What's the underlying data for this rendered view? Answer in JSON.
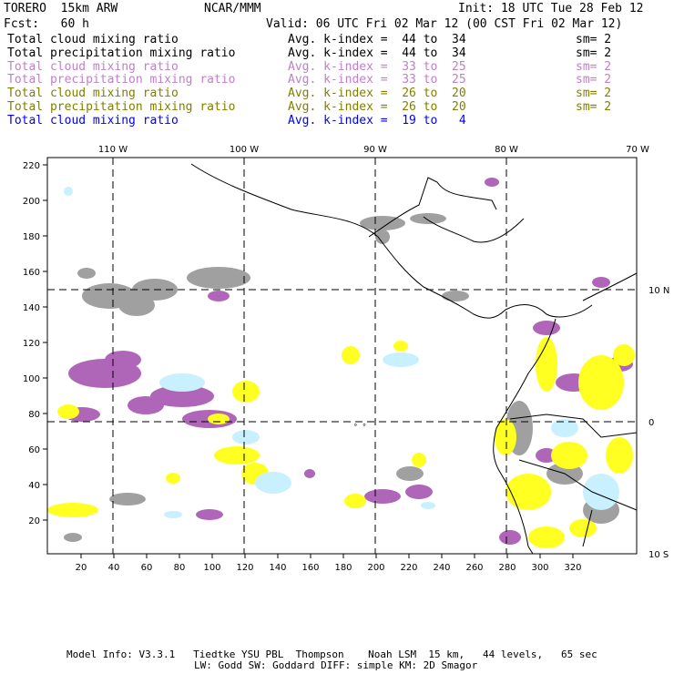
{
  "header": {
    "model": "TORERO  15km ARW",
    "org": "NCAR/MMM",
    "init": "Init: 18 UTC Tue 28 Feb 12",
    "fcst": "Fcst:   60 h",
    "valid": "Valid: 06 UTC Fri 02 Mar 12 (00 CST Fri 02 Mar 12)"
  },
  "legend": [
    {
      "field": "Total cloud mixing ratio",
      "range": "Avg. k-index =  44 to  34",
      "sm": "sm= 2",
      "color": "#000000"
    },
    {
      "field": "Total precipitation mixing ratio",
      "range": "Avg. k-index =  44 to  34",
      "sm": "sm= 2",
      "color": "#000000"
    },
    {
      "field": "Total cloud mixing ratio",
      "range": "Avg. k-index =  33 to  25",
      "sm": "sm= 2",
      "color": "#c080c8"
    },
    {
      "field": "Total precipitation mixing ratio",
      "range": "Avg. k-index =  33 to  25",
      "sm": "sm= 2",
      "color": "#c080c8"
    },
    {
      "field": "Total cloud mixing ratio",
      "range": "Avg. k-index =  26 to  20",
      "sm": "sm= 2",
      "color": "#808000"
    },
    {
      "field": "Total precipitation mixing ratio",
      "range": "Avg. k-index =  26 to  20",
      "sm": "sm= 2",
      "color": "#808000"
    },
    {
      "field": "Total cloud mixing ratio",
      "range": "Avg. k-index =  19 to   4",
      "sm": "",
      "color": "#0000ff"
    }
  ],
  "lon_labels": [
    "110 W",
    "100 W",
    "90 W",
    "80 W",
    "70 W"
  ],
  "lat_labels": [
    "10 N",
    "0",
    "10 S"
  ],
  "x_ticks": [
    "20",
    "40",
    "60",
    "80",
    "100",
    "120",
    "140",
    "160",
    "180",
    "200",
    "220",
    "240",
    "260",
    "280",
    "300",
    "320"
  ],
  "y_ticks": [
    "20",
    "40",
    "60",
    "80",
    "100",
    "120",
    "140",
    "160",
    "180",
    "200",
    "220"
  ],
  "footer": {
    "line1": "Model Info: V3.3.1   Tiedtke YSU PBL  Thompson    Noah LSM  15 km,   44 levels,   65 sec",
    "line2": "LW: Godd SW: Goddard DIFF: simple KM: 2D Smagor"
  },
  "colors": {
    "gray": "#a0a0a0",
    "purple": "#b066b8",
    "yellow": "#ffff22",
    "lightblue": "#c8f0ff"
  }
}
